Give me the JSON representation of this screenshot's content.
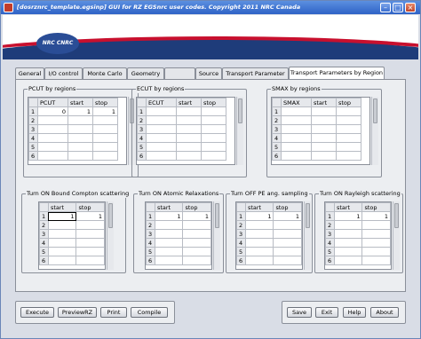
{
  "window": {
    "title": "[dosrznrc_template.egsinp] GUI for RZ EGSnrc user codes. Copyright 2011 NRC Canada"
  },
  "banner": {
    "logo_text": "NRC CNRC"
  },
  "tabs": [
    {
      "label": "General",
      "state": "normal"
    },
    {
      "label": "I/O control",
      "state": "normal"
    },
    {
      "label": "Monte Carlo",
      "state": "normal"
    },
    {
      "label": "Geometry",
      "state": "normal"
    },
    {
      "label": "",
      "state": "disabled"
    },
    {
      "label": "Source",
      "state": "normal"
    },
    {
      "label": "Transport Parameter",
      "state": "normal"
    },
    {
      "label": "Transport Parameters by Region",
      "state": "active"
    }
  ],
  "groups": {
    "pcut": {
      "title": "PCUT by regions",
      "columns": [
        "PCUT",
        "start",
        "stop"
      ],
      "rows": [
        [
          "1",
          "0",
          "1",
          "1"
        ],
        [
          "2",
          "",
          "",
          ""
        ],
        [
          "3",
          "",
          "",
          ""
        ],
        [
          "4",
          "",
          "",
          ""
        ],
        [
          "5",
          "",
          "",
          ""
        ],
        [
          "6",
          "",
          "",
          ""
        ]
      ]
    },
    "ecut": {
      "title": "ECUT by regions",
      "columns": [
        "ECUT",
        "start",
        "stop"
      ],
      "rows": [
        [
          "1",
          "",
          "",
          ""
        ],
        [
          "2",
          "",
          "",
          ""
        ],
        [
          "3",
          "",
          "",
          ""
        ],
        [
          "4",
          "",
          "",
          ""
        ],
        [
          "5",
          "",
          "",
          ""
        ],
        [
          "6",
          "",
          "",
          ""
        ]
      ]
    },
    "smax": {
      "title": "SMAX by regions",
      "columns": [
        "SMAX",
        "start",
        "stop"
      ],
      "rows": [
        [
          "1",
          "",
          "",
          ""
        ],
        [
          "2",
          "",
          "",
          ""
        ],
        [
          "3",
          "",
          "",
          ""
        ],
        [
          "4",
          "",
          "",
          ""
        ],
        [
          "5",
          "",
          "",
          ""
        ],
        [
          "6",
          "",
          "",
          ""
        ]
      ]
    },
    "compton": {
      "title": "Turn ON Bound Compton scattering",
      "columns": [
        "start",
        "stop"
      ],
      "rows": [
        [
          "1",
          "1",
          "1"
        ],
        [
          "2",
          "",
          ""
        ],
        [
          "3",
          "",
          ""
        ],
        [
          "4",
          "",
          ""
        ],
        [
          "5",
          "",
          ""
        ],
        [
          "6",
          "",
          ""
        ]
      ]
    },
    "relax": {
      "title": "Turn ON Atomic Relaxations",
      "columns": [
        "start",
        "stop"
      ],
      "rows": [
        [
          "1",
          "1",
          "1"
        ],
        [
          "2",
          "",
          ""
        ],
        [
          "3",
          "",
          ""
        ],
        [
          "4",
          "",
          ""
        ],
        [
          "5",
          "",
          ""
        ],
        [
          "6",
          "",
          ""
        ]
      ]
    },
    "pe": {
      "title": "Turn OFF PE ang. sampling",
      "columns": [
        "start",
        "stop"
      ],
      "rows": [
        [
          "1",
          "1",
          "1"
        ],
        [
          "2",
          "",
          ""
        ],
        [
          "3",
          "",
          ""
        ],
        [
          "4",
          "",
          ""
        ],
        [
          "5",
          "",
          ""
        ],
        [
          "6",
          "",
          ""
        ]
      ]
    },
    "rayleigh": {
      "title": "Turn ON Rayleigh scattering",
      "columns": [
        "start",
        "stop"
      ],
      "rows": [
        [
          "1",
          "1",
          "1"
        ],
        [
          "2",
          "",
          ""
        ],
        [
          "3",
          "",
          ""
        ],
        [
          "4",
          "",
          ""
        ],
        [
          "5",
          "",
          ""
        ],
        [
          "6",
          "",
          ""
        ]
      ]
    }
  },
  "buttons": {
    "execute": "Execute",
    "preview": "PreviewRZ",
    "print": "Print",
    "compile": "Compile",
    "save": "Save",
    "exit": "Exit",
    "help": "Help",
    "about": "About"
  },
  "colors": {
    "titlebar": "#2e62c6",
    "accent_red": "#c8102e",
    "banner_blue": "#1e3c7a"
  }
}
